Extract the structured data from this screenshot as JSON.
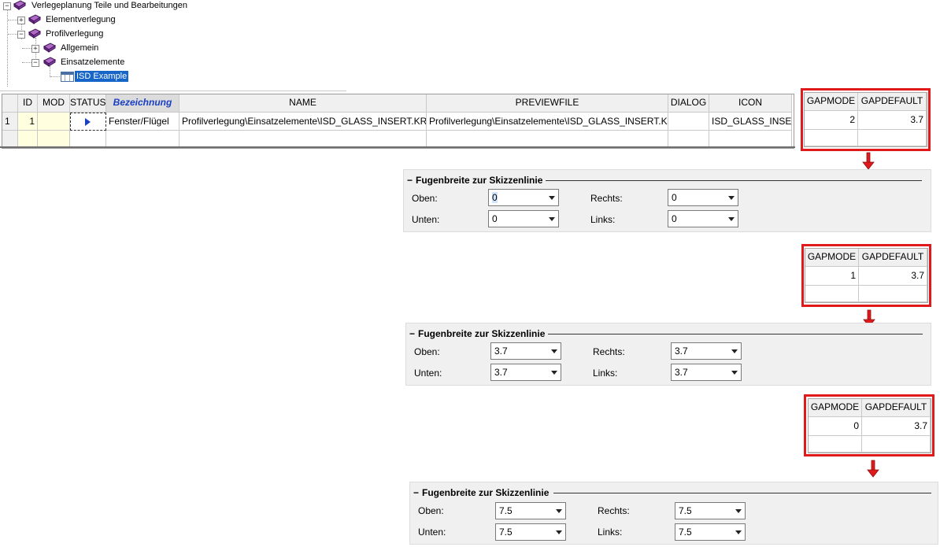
{
  "tree": {
    "root": "Verlegeplanung Teile und Bearbeitungen",
    "items": [
      {
        "label": "Elementverlegung"
      },
      {
        "label": "Profilverlegung"
      },
      {
        "label": "Allgemein"
      },
      {
        "label": "Einsatzelemente"
      },
      {
        "label": "ISD Example"
      }
    ]
  },
  "grid": {
    "columns": [
      "ID",
      "MOD",
      "STATUS",
      "Bezeichnung",
      "NAME",
      "PREVIEWFILE",
      "DIALOG",
      "ICON"
    ],
    "row": {
      "rownum": "1",
      "id": "1",
      "mod": "",
      "bezeichnung": "Fenster/Flügel",
      "name": "Profilverlegung\\Einsatzelemente\\ISD_GLASS_INSERT.KRA",
      "previewfile": "Profilverlegung\\Einsatzelemente\\ISD_GLASS_INSERT.KRA",
      "dialog": "",
      "icon": "ISD_GLASS_INSERT"
    }
  },
  "gap_header": {
    "mode": "GAPMODE",
    "default": "GAPDEFAULT"
  },
  "gap_tables": [
    {
      "mode": "2",
      "default": "3.7"
    },
    {
      "mode": "1",
      "default": "3.7"
    },
    {
      "mode": "0",
      "default": "3.7"
    }
  ],
  "panel_labels": {
    "title": "Fugenbreite zur Skizzenlinie",
    "oben": "Oben:",
    "unten": "Unten:",
    "rechts": "Rechts:",
    "links": "Links:"
  },
  "panels": [
    {
      "oben": "0",
      "unten": "0",
      "rechts": "0",
      "links": "0"
    },
    {
      "oben": "3.7",
      "unten": "3.7",
      "rechts": "3.7",
      "links": "3.7"
    },
    {
      "oben": "7.5",
      "unten": "7.5",
      "rechts": "7.5",
      "links": "7.5"
    }
  ],
  "colors": {
    "highlight": "#e01a1a",
    "selection": "#1665c9",
    "header_link": "#1a3fc4"
  }
}
